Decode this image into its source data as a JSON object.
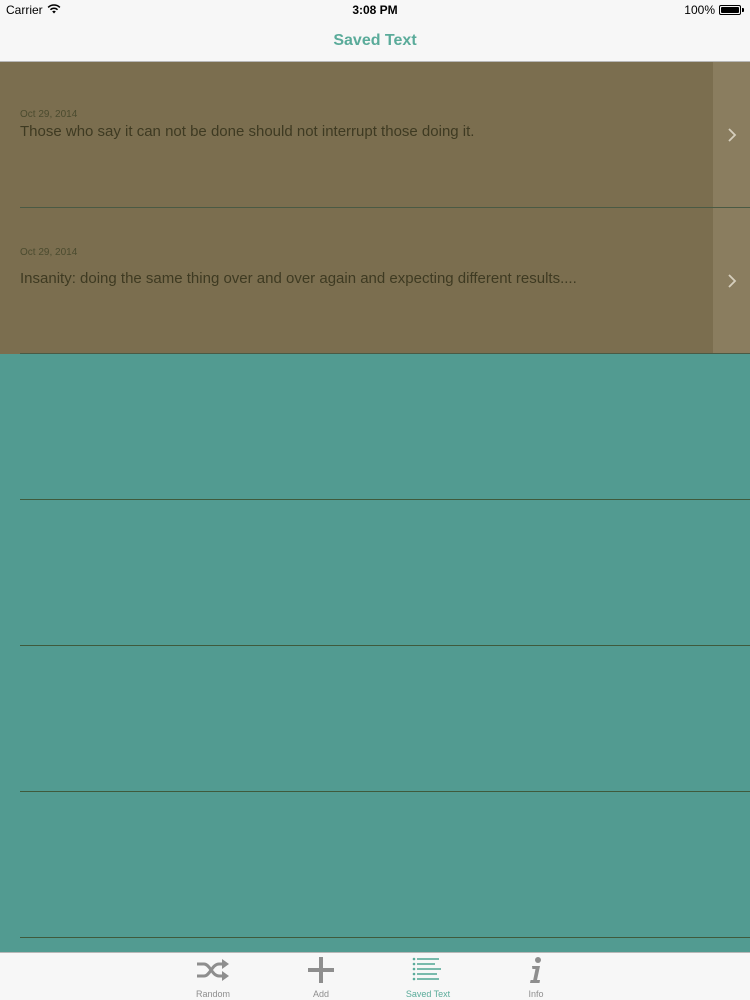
{
  "status_bar": {
    "carrier": "Carrier",
    "time": "3:08 PM",
    "battery": "100%"
  },
  "nav": {
    "title": "Saved Text"
  },
  "rows": [
    {
      "date": "Oct 29, 2014",
      "text": "Those who say it can not be done should not interrupt those doing it."
    },
    {
      "date": "Oct 29, 2014",
      "text": "Insanity: doing the same thing over and over again and expecting different results...."
    }
  ],
  "tabs": [
    {
      "label": "Random",
      "icon": "shuffle-icon"
    },
    {
      "label": "Add",
      "icon": "plus-icon"
    },
    {
      "label": "Saved Text",
      "icon": "list-icon"
    },
    {
      "label": "Info",
      "icon": "info-icon"
    }
  ],
  "colors": {
    "accent": "#5aab9a",
    "background": "#529b91",
    "row_filled": "#7b6e4f"
  }
}
